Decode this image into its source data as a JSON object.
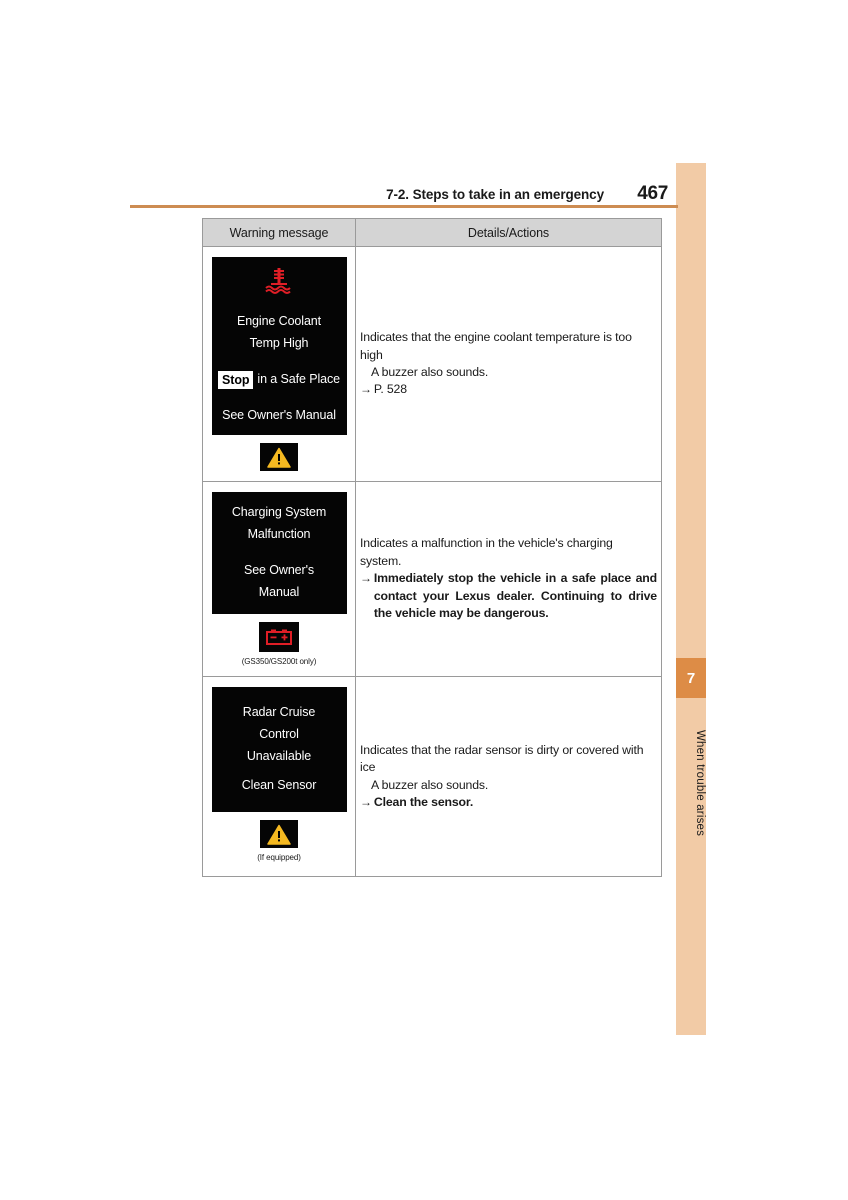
{
  "header": {
    "section_title": "7-2. Steps to take in an emergency",
    "page_number": "467"
  },
  "side_tab": {
    "chapter_number": "7",
    "chapter_label": "When trouble arises",
    "strip_color": "#f2cba6",
    "marker_color": "#dd8c46"
  },
  "table": {
    "columns": {
      "warning_message": "Warning message",
      "details_actions": "Details/Actions"
    },
    "rows": [
      {
        "display": {
          "icon": "coolant-temperature-icon",
          "icon_color": "#e01e26",
          "lines": [
            "Engine Coolant",
            "Temp High"
          ],
          "stop_chip": "Stop",
          "stop_rest": "in a Safe Place",
          "footer_line": "See Owner's Manual"
        },
        "indicator": {
          "icon": "master-warning-triangle-icon",
          "icon_color": "#f5b921",
          "caption": ""
        },
        "details": {
          "line1": "Indicates that the engine coolant temperature is too high",
          "line2": "A buzzer also sounds.",
          "arrow": "→",
          "reference": "P. 528"
        }
      },
      {
        "display": {
          "icon": "",
          "lines": [
            "Charging System",
            "Malfunction",
            "See Owner's",
            "Manual"
          ]
        },
        "indicator": {
          "icon": "battery-warning-icon",
          "icon_color": "#e01e26",
          "caption": "(GS350/GS200t only)"
        },
        "details": {
          "line1": "Indicates a malfunction in the vehicle's charging system.",
          "arrow": "→",
          "action": "Immediately stop the vehicle in a safe place and contact your Lexus dealer. Continuing to drive the vehicle may be dangerous."
        }
      },
      {
        "display": {
          "icon": "",
          "lines": [
            "Radar Cruise",
            "Control",
            "Unavailable",
            "Clean Sensor"
          ]
        },
        "indicator": {
          "icon": "master-warning-triangle-icon",
          "icon_color": "#f5b921",
          "caption": "(If equipped)"
        },
        "details": {
          "line1": "Indicates that the radar sensor is dirty or covered with ice",
          "line2": "A buzzer also sounds.",
          "arrow": "→",
          "action": "Clean the sensor."
        }
      }
    ]
  }
}
